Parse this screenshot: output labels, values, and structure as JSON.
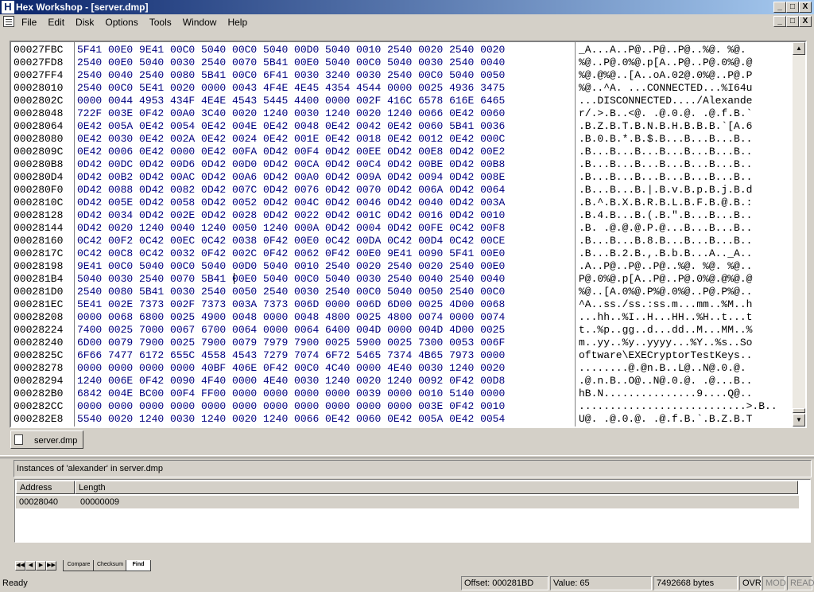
{
  "window": {
    "app_icon": "H",
    "title": "Hex Workshop - [server.dmp]",
    "caption_buttons": [
      "_",
      "□",
      "X"
    ]
  },
  "menu": [
    "File",
    "Edit",
    "Disk",
    "Options",
    "Tools",
    "Window",
    "Help"
  ],
  "hex": {
    "rows": [
      {
        "offset": "00027FBC",
        "bytes": "5F41 00E0 9E41 00C0 5040 00C0 5040 00D0 5040 0010 2540 0020 2540 0020",
        "ascii": "_A...A..P@..P@..P@..%@. %@."
      },
      {
        "offset": "00027FD8",
        "bytes": "2540 00E0 5040 0030 2540 0070 5B41 00E0 5040 00C0 5040 0030 2540 0040",
        "ascii": "%@..P@.0%@.p[A..P@..P@.0%@.@"
      },
      {
        "offset": "00027FF4",
        "bytes": "2540 0040 2540 0080 5B41 00C0 6F41 0030 3240 0030 2540 00C0 5040 0050",
        "ascii": "%@.@%@..[A..oA.02@.0%@..P@.P"
      },
      {
        "offset": "00028010",
        "bytes": "2540 00C0 5E41 0020 0000 0043 4F4E 4E45 4354 4544 0000 0025 4936 3475",
        "ascii": "%@..^A. ...CONNECTED...%I64u"
      },
      {
        "offset": "0002802C",
        "bytes": "0000 0044 4953 434F 4E4E 4543 5445 4400 0000 002F 416C 6578 616E 6465",
        "ascii": "...DISCONNECTED..../Alexande"
      },
      {
        "offset": "00028048",
        "bytes": "722F 003E 0F42 00A0 3C40 0020 1240 0030 1240 0020 1240 0066 0E42 0060",
        "ascii": "r/.>.B..<@. .@.0.@. .@.f.B.`"
      },
      {
        "offset": "00028064",
        "bytes": "0E42 005A 0E42 0054 0E42 004E 0E42 0048 0E42 0042 0E42 0060 5B41 0036",
        "ascii": ".B.Z.B.T.B.N.B.H.B.B.B.`[A.6"
      },
      {
        "offset": "00028080",
        "bytes": "0E42 0030 0E42 002A 0E42 0024 0E42 001E 0E42 0018 0E42 0012 0E42 000C",
        "ascii": ".B.0.B.*.B.$.B...B...B...B.."
      },
      {
        "offset": "0002809C",
        "bytes": "0E42 0006 0E42 0000 0E42 00FA 0D42 00F4 0D42 00EE 0D42 00E8 0D42 00E2",
        "ascii": ".B...B...B...B...B...B...B.."
      },
      {
        "offset": "000280B8",
        "bytes": "0D42 00DC 0D42 00D6 0D42 00D0 0D42 00CA 0D42 00C4 0D42 00BE 0D42 00B8",
        "ascii": ".B...B...B...B...B...B...B.."
      },
      {
        "offset": "000280D4",
        "bytes": "0D42 00B2 0D42 00AC 0D42 00A6 0D42 00A0 0D42 009A 0D42 0094 0D42 008E",
        "ascii": ".B...B...B...B...B...B...B.."
      },
      {
        "offset": "000280F0",
        "bytes": "0D42 0088 0D42 0082 0D42 007C 0D42 0076 0D42 0070 0D42 006A 0D42 0064",
        "ascii": ".B...B...B.|.B.v.B.p.B.j.B.d"
      },
      {
        "offset": "0002810C",
        "bytes": "0D42 005E 0D42 0058 0D42 0052 0D42 004C 0D42 0046 0D42 0040 0D42 003A",
        "ascii": ".B.^.B.X.B.R.B.L.B.F.B.@.B.:"
      },
      {
        "offset": "00028128",
        "bytes": "0D42 0034 0D42 002E 0D42 0028 0D42 0022 0D42 001C 0D42 0016 0D42 0010",
        "ascii": ".B.4.B...B.(.B.\".B...B...B.."
      },
      {
        "offset": "00028144",
        "bytes": "0D42 0020 1240 0040 1240 0050 1240 000A 0D42 0004 0D42 00FE 0C42 00F8",
        "ascii": ".B. .@.@.@.P.@...B...B...B.."
      },
      {
        "offset": "00028160",
        "bytes": "0C42 00F2 0C42 00EC 0C42 0038 0F42 00E0 0C42 00DA 0C42 00D4 0C42 00CE",
        "ascii": ".B...B...B.8.B...B...B...B.."
      },
      {
        "offset": "0002817C",
        "bytes": "0C42 00C8 0C42 0032 0F42 002C 0F42 0062 0F42 00E0 9E41 0090 5F41 00E0",
        "ascii": ".B...B.2.B.,.B.b.B...A.._A.."
      },
      {
        "offset": "00028198",
        "bytes": "9E41 00C0 5040 00C0 5040 00D0 5040 0010 2540 0020 2540 0020 2540 00E0",
        "ascii": ".A..P@..P@..P@..%@. %@. %@.."
      },
      {
        "offset": "000281B4",
        "bytes": "5040 0030 2540 0070 5B41 00E0 5040 00C0 5040 0030 2540 0040 2540 0040",
        "ascii": "P@.0%@.p[A..P@..P@.0%@.@%@.@"
      },
      {
        "offset": "000281D0",
        "bytes": "2540 0080 5B41 0030 2540 0050 2540 0030 2540 00C0 5040 0050 2540 00C0",
        "ascii": "%@..[A.0%@.P%@.0%@..P@.P%@.."
      },
      {
        "offset": "000281EC",
        "bytes": "5E41 002E 7373 002F 7373 003A 7373 006D 0000 006D 6D00 0025 4D00 0068",
        "ascii": "^A..ss./ss.:ss.m...mm..%M..h"
      },
      {
        "offset": "00028208",
        "bytes": "0000 0068 6800 0025 4900 0048 0000 0048 4800 0025 4800 0074 0000 0074",
        "ascii": "...hh..%I..H...HH..%H..t...t"
      },
      {
        "offset": "00028224",
        "bytes": "7400 0025 7000 0067 6700 0064 0000 0064 6400 004D 0000 004D 4D00 0025",
        "ascii": "t..%p..gg..d...dd..M...MM..%"
      },
      {
        "offset": "00028240",
        "bytes": "6D00 0079 7900 0025 7900 0079 7979 7900 0025 5900 0025 7300 0053 006F",
        "ascii": "m..yy..%y..yyyy...%Y..%s..So"
      },
      {
        "offset": "0002825C",
        "bytes": "6F66 7477 6172 655C 4558 4543 7279 7074 6F72 5465 7374 4B65 7973 0000",
        "ascii": "oftware\\EXECryptorTestKeys.."
      },
      {
        "offset": "00028278",
        "bytes": "0000 0000 0000 0000 40BF 406E 0F42 00C0 4C40 0000 4E40 0030 1240 0020",
        "ascii": "........@.@n.B..L@..N@.0.@. "
      },
      {
        "offset": "00028294",
        "bytes": "1240 006E 0F42 0090 4F40 0000 4E40 0030 1240 0020 1240 0092 0F42 00D8",
        "ascii": ".@.n.B..O@..N@.0.@. .@...B.."
      },
      {
        "offset": "000282B0",
        "bytes": "6842 004E BC00 00F4 FF00 0000 0000 0000 0000 0039 0000 0010 5140 0000",
        "ascii": "hB.N...............9....Q@.."
      },
      {
        "offset": "000282CC",
        "bytes": "0000 0000 0000 0000 0000 0000 0000 0000 0000 0000 0000 003E 0F42 0010",
        "ascii": "...........................>.B.."
      },
      {
        "offset": "000282E8",
        "bytes": "5540 0020 1240 0030 1240 0020 1240 0066 0E42 0060 0E42 005A 0E42 0054",
        "ascii": "U@. .@.0.@. .@.f.B.`.B.Z.B.T"
      }
    ]
  },
  "doc_tab": {
    "label": "server.dmp",
    "icon": "document-icon"
  },
  "results": {
    "header": "Instances of 'alexander' in server.dmp",
    "columns": [
      "Address",
      "Length"
    ],
    "rows": [
      {
        "address": "00028040",
        "length": "00000009"
      }
    ]
  },
  "bottom_tabs": [
    "Compare",
    "Checksum",
    "Find"
  ],
  "nav_buttons": [
    "◀◀",
    "◀",
    "▶",
    "▶▶"
  ],
  "status": {
    "ready": "Ready",
    "offset": "Offset: 000281BD",
    "value": "Value: 65",
    "size": "7492668 bytes",
    "ovr": "OVR",
    "mod": "MOD",
    "read": "READ"
  }
}
